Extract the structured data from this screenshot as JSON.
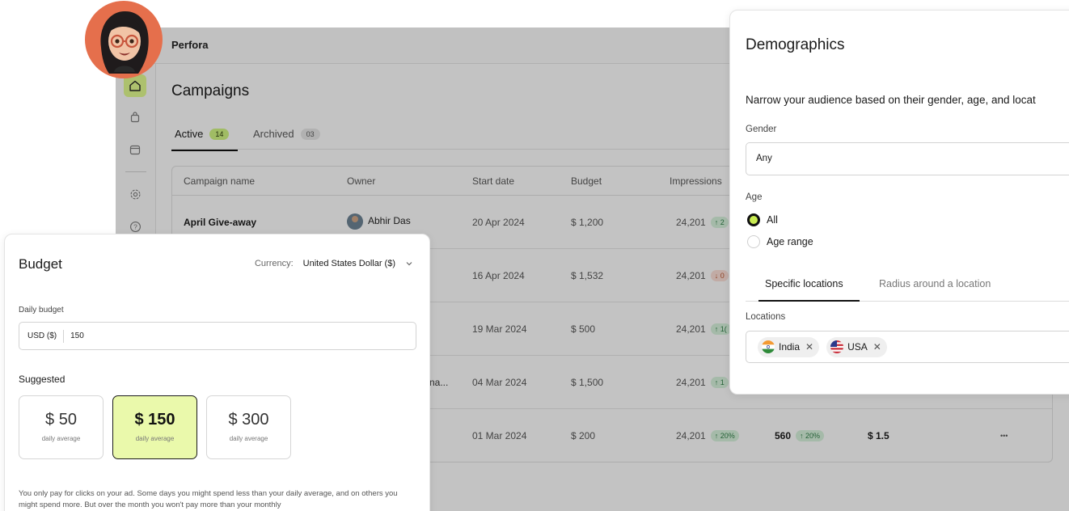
{
  "app": {
    "brand": "Perfora",
    "page_title": "Campaigns",
    "tabs": [
      {
        "label": "Active",
        "count": "14"
      },
      {
        "label": "Archived",
        "count": "03"
      }
    ],
    "table": {
      "headers": [
        "Campaign name",
        "Owner",
        "Start date",
        "Budget",
        "Impressions"
      ],
      "rows": [
        {
          "name": "April Give-away",
          "owner": "Abhir Das",
          "start": "20 Apr 2024",
          "budget": "$ 1,200",
          "impressions": "24,201",
          "imp_change": "↑ 2",
          "imp_dir": "up"
        },
        {
          "name": "",
          "owner": "",
          "start": "16 Apr 2024",
          "budget": "$ 1,532",
          "impressions": "24,201",
          "imp_change": "↓ 0",
          "imp_dir": "down"
        },
        {
          "name": "",
          "owner": "",
          "start": "19 Mar 2024",
          "budget": "$ 500",
          "impressions": "24,201",
          "imp_change": "↑ 1(",
          "imp_dir": "up"
        },
        {
          "name": "na...",
          "owner": "",
          "start": "04 Mar 2024",
          "budget": "$ 1,500",
          "impressions": "24,201",
          "imp_change": "↑ 1",
          "imp_dir": "up"
        },
        {
          "name": "",
          "owner": "",
          "start": "01 Mar 2024",
          "budget": "$ 200",
          "impressions": "24,201",
          "imp_change": "↑ 20%",
          "imp_dir": "up",
          "clicks": "560",
          "clicks_change": "↑ 20%",
          "cpc": "$ 1.5",
          "more": "•••"
        }
      ]
    }
  },
  "budget": {
    "title": "Budget",
    "currency_label": "Currency:",
    "currency_value": "United States Dollar ($)",
    "daily_label": "Daily budget",
    "input_prefix": "USD ($)",
    "input_value": "150",
    "suggested_label": "Suggested",
    "options": [
      {
        "amount": "$ 50",
        "sub": "daily average",
        "selected": false
      },
      {
        "amount": "$ 150",
        "sub": "daily average",
        "selected": true
      },
      {
        "amount": "$ 300",
        "sub": "daily average",
        "selected": false
      }
    ],
    "note": "You only pay for clicks on your ad. Some days you might spend less than your daily average, and on others you might spend more. But over the month you won't pay more than your monthly"
  },
  "demographics": {
    "title": "Demographics",
    "description": "Narrow your audience based on their gender, age, and locat",
    "gender_label": "Gender",
    "gender_value": "Any",
    "age_label": "Age",
    "age_options": [
      {
        "label": "All",
        "selected": true
      },
      {
        "label": "Age range",
        "selected": false
      }
    ],
    "location_tabs": [
      "Specific locations",
      "Radius around a location"
    ],
    "locations_label": "Locations",
    "locations": [
      {
        "name": "India",
        "flag": "india-flag-icon"
      },
      {
        "name": "USA",
        "flag": "usa-flag-icon"
      }
    ]
  },
  "colors": {
    "accent": "#c9ec7d",
    "selected_option": "#eaf9ab",
    "avatar_bg": "#e56f4c"
  }
}
